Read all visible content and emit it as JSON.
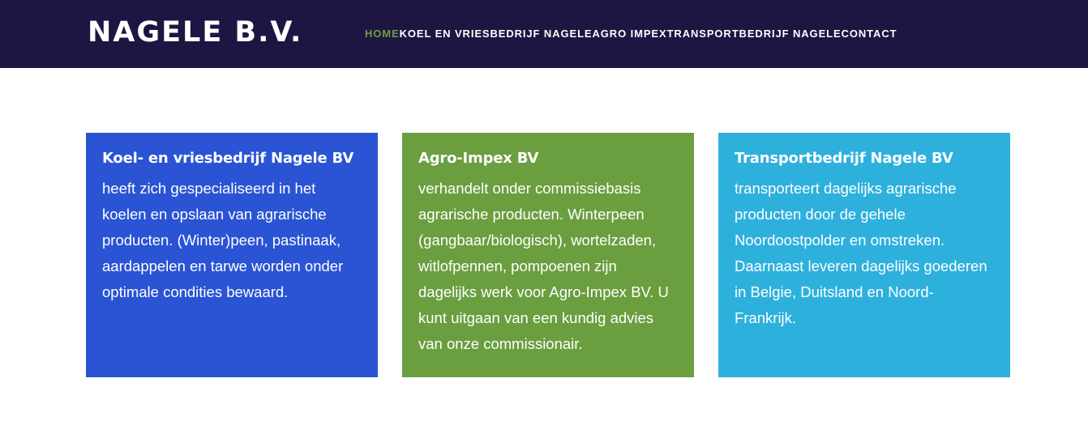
{
  "header": {
    "logo": "NAGELE B.V.",
    "nav": [
      {
        "label": "HOME",
        "active": true
      },
      {
        "label": "KOEL EN VRIESBEDRIJF NAGELE",
        "active": false
      },
      {
        "label": "AGRO IMPEX",
        "active": false
      },
      {
        "label": "TRANSPORTBEDRIJF NAGELE",
        "active": false
      },
      {
        "label": "CONTACT",
        "active": false
      }
    ]
  },
  "cards": [
    {
      "title": "Koel- en vriesbedrijf Nagele BV",
      "text": "heeft zich gespecialiseerd in het koelen en opslaan van agrarische producten. (Winter)peen, pastinaak, aardappelen en tarwe worden onder optimale condities bewaard.",
      "color": "#2a54d4"
    },
    {
      "title": "Agro-Impex BV",
      "text": "verhandelt onder commissiebasis agrarische producten. Winterpeen (gangbaar/biologisch), wortelzaden, witlofpennen, pompoenen zijn dagelijks werk voor Agro-Impex BV. U kunt uitgaan van een kundig advies van onze commissionair.",
      "color": "#6a9e3f"
    },
    {
      "title": "Transportbedrijf Nagele BV",
      "text": "transporteert dagelijks agrarische producten door de gehele Noordoostpolder en omstreken. Daarnaast leveren dagelijks goederen in Belgie, Duitsland en Noord-Frankrijk.",
      "color": "#2eb0dd"
    }
  ],
  "colors": {
    "header_bg": "#1f1542",
    "nav_active": "#6a9e3f",
    "text_light": "#ffffff"
  }
}
